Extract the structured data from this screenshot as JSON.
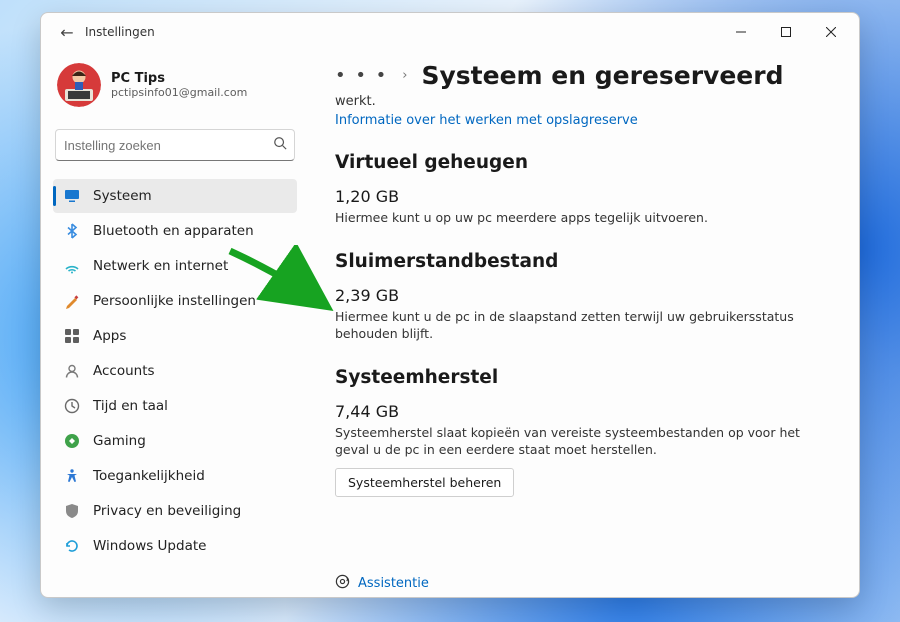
{
  "window": {
    "app_title": "Instellingen"
  },
  "profile": {
    "name": "PC Tips",
    "email": "pctipsinfo01@gmail.com"
  },
  "search": {
    "placeholder": "Instelling zoeken"
  },
  "sidebar": {
    "items": [
      {
        "label": "Systeem",
        "icon": "system",
        "selected": true
      },
      {
        "label": "Bluetooth en apparaten",
        "icon": "bluetooth"
      },
      {
        "label": "Netwerk en internet",
        "icon": "network"
      },
      {
        "label": "Persoonlijke instellingen",
        "icon": "personalization"
      },
      {
        "label": "Apps",
        "icon": "apps"
      },
      {
        "label": "Accounts",
        "icon": "accounts"
      },
      {
        "label": "Tijd en taal",
        "icon": "time"
      },
      {
        "label": "Gaming",
        "icon": "gaming"
      },
      {
        "label": "Toegankelijkheid",
        "icon": "accessibility"
      },
      {
        "label": "Privacy en beveiliging",
        "icon": "privacy"
      },
      {
        "label": "Windows Update",
        "icon": "update"
      }
    ]
  },
  "breadcrumb": {
    "overflow_glyph": "• • •",
    "title": "Systeem en gereserveerd"
  },
  "top_fragment": {
    "truncated_line": "werkt.",
    "link": "Informatie over het werken met opslagreserve"
  },
  "sections": {
    "virtual_memory": {
      "heading": "Virtueel geheugen",
      "value": "1,20 GB",
      "description": "Hiermee kunt u op uw pc meerdere apps tegelijk uitvoeren."
    },
    "hibernation": {
      "heading": "Sluimerstandbestand",
      "value": "2,39 GB",
      "description": "Hiermee kunt u de pc in de slaapstand zetten terwijl uw gebruikersstatus behouden blijft."
    },
    "system_restore": {
      "heading": "Systeemherstel",
      "value": "7,44 GB",
      "description": "Systeemherstel slaat kopieën van vereiste systeembestanden op voor het geval u de pc in een eerdere staat moet herstellen.",
      "button": "Systeemherstel beheren"
    }
  },
  "assist_link": "Assistentie",
  "colors": {
    "accent": "#0067c0",
    "arrow": "#17a321"
  }
}
